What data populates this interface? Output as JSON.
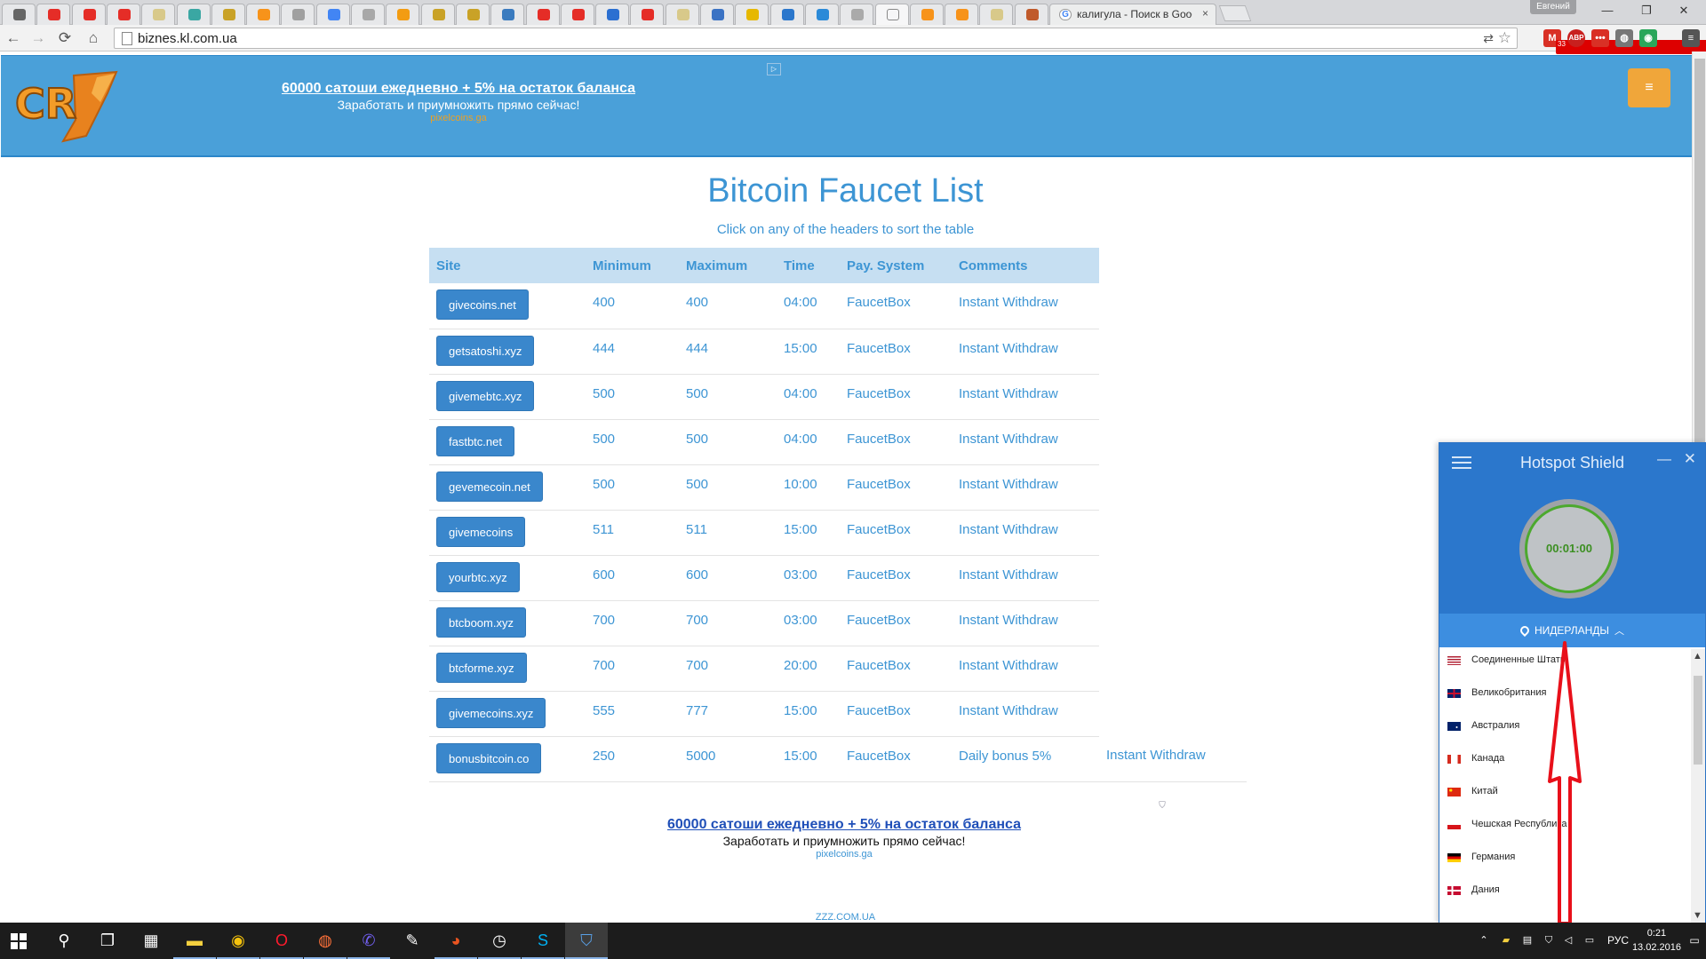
{
  "browser": {
    "tabs": [
      {
        "color": "#666666"
      },
      {
        "color": "#e52d27"
      },
      {
        "color": "#e52d27"
      },
      {
        "color": "#e52d27"
      },
      {
        "color": "#d8c98a"
      },
      {
        "color": "#3aa7a3"
      },
      {
        "color": "#c9a227"
      },
      {
        "color": "#f7931a"
      },
      {
        "color": "#a0a0a0"
      },
      {
        "color": "#4285f4"
      },
      {
        "color": "#a8a8a8"
      },
      {
        "color": "#f39c12"
      },
      {
        "color": "#c9a227"
      },
      {
        "color": "#c9a227"
      },
      {
        "color": "#3a7bbf"
      },
      {
        "color": "#e52d27"
      },
      {
        "color": "#e52d27"
      },
      {
        "color": "#2b6fd1"
      },
      {
        "color": "#e52d27"
      },
      {
        "color": "#d8c98a"
      },
      {
        "color": "#3b73c4"
      },
      {
        "color": "#e6b800"
      },
      {
        "color": "#2b77cc"
      },
      {
        "color": "#2b8ad8"
      },
      {
        "color": "#aaaaaa"
      },
      {
        "color": "#f6f6f7"
      },
      {
        "color": "#f7931a"
      },
      {
        "color": "#f7931a"
      },
      {
        "color": "#d8c98a"
      },
      {
        "color": "#c05a2b"
      }
    ],
    "active_tab_title": "калигула - Поиск в Googl",
    "tab_close": "×",
    "user_badge": "Евгений",
    "window_controls": {
      "minimize": "—",
      "maximize": "❐",
      "close": "✕"
    },
    "nav": {
      "back": "←",
      "forward": "→",
      "reload": "⟳",
      "home": "⌂"
    },
    "url": "biznes.kl.com.ua",
    "translate_icon": "⇄",
    "star_icon": "☆",
    "extensions": [
      {
        "label": "M",
        "color": "#d93025",
        "badge": "33"
      },
      {
        "label": "ABP",
        "color": "#c8201e",
        "badge": ""
      },
      {
        "label": "•••",
        "color": "#d93025",
        "badge": ""
      },
      {
        "label": "◍",
        "color": "#777777",
        "badge": ""
      },
      {
        "label": "◉",
        "color": "#2aa65a",
        "badge": ""
      },
      {
        "label": "≡",
        "color": "#555555",
        "badge": ""
      }
    ]
  },
  "header": {
    "logo_text": "CR",
    "ad": {
      "link": "60000 сатоши ежедневно + 5% на остаток баланса",
      "sub": "Заработать и приумножить прямо сейчас!",
      "domain": "pixelcoins.ga"
    },
    "ad_choices_icon": "▷",
    "menu_icon": "≡"
  },
  "main": {
    "title": "Bitcoin Faucet List",
    "subtitle": "Click on any of the headers to sort the table",
    "columns": [
      "Site",
      "Minimum",
      "Maximum",
      "Time",
      "Pay. System",
      "Comments"
    ],
    "rows": [
      {
        "site": "givecoins.net",
        "min": "400",
        "max": "400",
        "time": "04:00",
        "pay": "FaucetBox",
        "comment": "Instant Withdraw",
        "extra": ""
      },
      {
        "site": "getsatoshi.xyz",
        "min": "444",
        "max": "444",
        "time": "15:00",
        "pay": "FaucetBox",
        "comment": "Instant Withdraw",
        "extra": ""
      },
      {
        "site": "givemebtc.xyz",
        "min": "500",
        "max": "500",
        "time": "04:00",
        "pay": "FaucetBox",
        "comment": "Instant Withdraw",
        "extra": ""
      },
      {
        "site": "fastbtc.net",
        "min": "500",
        "max": "500",
        "time": "04:00",
        "pay": "FaucetBox",
        "comment": "Instant Withdraw",
        "extra": ""
      },
      {
        "site": "gevemecoin.net",
        "min": "500",
        "max": "500",
        "time": "10:00",
        "pay": "FaucetBox",
        "comment": "Instant Withdraw",
        "extra": ""
      },
      {
        "site": "givemecoins",
        "min": "511",
        "max": "511",
        "time": "15:00",
        "pay": "FaucetBox",
        "comment": "Instant Withdraw",
        "extra": ""
      },
      {
        "site": "yourbtc.xyz",
        "min": "600",
        "max": "600",
        "time": "03:00",
        "pay": "FaucetBox",
        "comment": "Instant Withdraw",
        "extra": ""
      },
      {
        "site": "btcboom.xyz",
        "min": "700",
        "max": "700",
        "time": "03:00",
        "pay": "FaucetBox",
        "comment": "Instant Withdraw",
        "extra": ""
      },
      {
        "site": "btcforme.xyz",
        "min": "700",
        "max": "700",
        "time": "20:00",
        "pay": "FaucetBox",
        "comment": "Instant Withdraw",
        "extra": ""
      },
      {
        "site": "givemecoins.xyz",
        "min": "555",
        "max": "777",
        "time": "15:00",
        "pay": "FaucetBox",
        "comment": "Instant Withdraw",
        "extra": ""
      },
      {
        "site": "bonusbitcoin.co",
        "min": "250",
        "max": "5000",
        "time": "15:00",
        "pay": "FaucetBox",
        "comment": "Daily bonus 5%",
        "extra": "Instant Withdraw"
      }
    ]
  },
  "bottom_ad": {
    "link": "60000 сатоши ежедневно + 5% на остаток баланса",
    "sub": "Заработать и приумножить прямо сейчас!",
    "domain": "pixelcoins.ga"
  },
  "footer": {
    "link": "ZZZ.COM.UA"
  },
  "hotspot_shield": {
    "title": "Hotspot Shield",
    "minimize": "—",
    "close": "✕",
    "timer": "00:01:00",
    "selected_country": "НИДЕРЛАНДЫ",
    "chevron": "︿",
    "countries": [
      {
        "name": "Соединенные Штаты",
        "flag": "us"
      },
      {
        "name": "Великобритания",
        "flag": "gb"
      },
      {
        "name": "Австралия",
        "flag": "au"
      },
      {
        "name": "Канада",
        "flag": "ca"
      },
      {
        "name": "Китай",
        "flag": "cn"
      },
      {
        "name": "Чешская Республика",
        "flag": "cz"
      },
      {
        "name": "Германия",
        "flag": "de"
      },
      {
        "name": "Дания",
        "flag": "dk"
      }
    ],
    "scroll_up": "▲",
    "scroll_down": "▼",
    "accent": "#2b77cc"
  },
  "taskbar": {
    "start_icon": "windows-logo",
    "apps": [
      {
        "name": "search",
        "glyph": "⚲"
      },
      {
        "name": "task-view",
        "glyph": "❐"
      },
      {
        "name": "calculator",
        "glyph": "▦"
      },
      {
        "name": "explorer",
        "glyph": "▬"
      },
      {
        "name": "chrome",
        "glyph": "◉"
      },
      {
        "name": "opera",
        "glyph": "O"
      },
      {
        "name": "firefox",
        "glyph": "◍"
      },
      {
        "name": "viber",
        "glyph": "✆"
      },
      {
        "name": "paint",
        "glyph": "✎"
      },
      {
        "name": "color-app",
        "glyph": "◕"
      },
      {
        "name": "clock-app",
        "glyph": "◷"
      },
      {
        "name": "skype",
        "glyph": "S"
      },
      {
        "name": "hotspot-shield",
        "glyph": "⛉"
      }
    ],
    "tray": {
      "up": "⌃",
      "language": "РУС",
      "notify": "▭"
    },
    "clock_time": "0:21",
    "clock_date": "13.02.2016"
  }
}
